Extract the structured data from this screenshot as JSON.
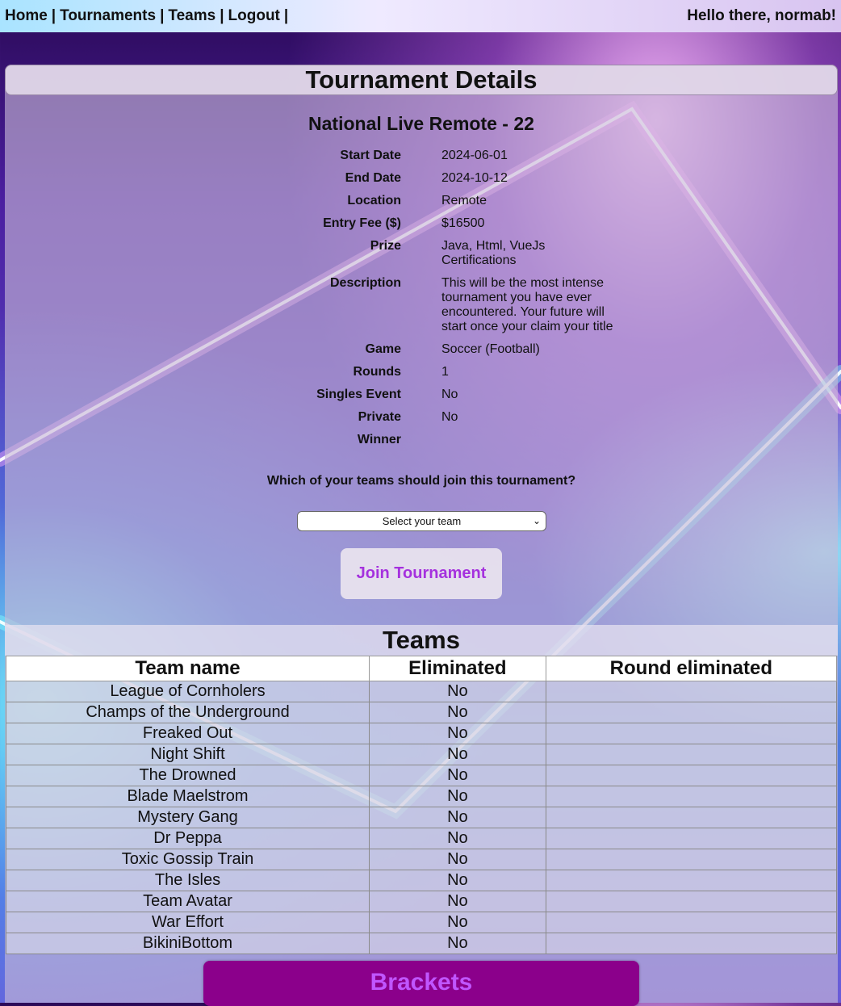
{
  "nav": {
    "links": [
      "Home",
      "Tournaments",
      "Teams",
      "Logout"
    ],
    "separator": "|",
    "greeting": "Hello there, normab!"
  },
  "panel": {
    "title": "Tournament Details",
    "tournament_name": "National Live Remote - 22"
  },
  "details": [
    {
      "label": "Start Date",
      "value": "2024-06-01"
    },
    {
      "label": "End Date",
      "value": "2024-10-12"
    },
    {
      "label": "Location",
      "value": "Remote"
    },
    {
      "label": "Entry Fee ($)",
      "value": "$16500"
    },
    {
      "label": "Prize",
      "value": "Java, Html, VueJs Certifications"
    },
    {
      "label": "Description",
      "value": "This will be the most intense tournament you have ever encountered. Your future will start once your claim your title"
    },
    {
      "label": "Game",
      "value": "Soccer (Football)"
    },
    {
      "label": "Rounds",
      "value": "1"
    },
    {
      "label": "Singles Event",
      "value": "No"
    },
    {
      "label": "Private",
      "value": "No"
    },
    {
      "label": "Winner",
      "value": ""
    }
  ],
  "join": {
    "question": "Which of your teams should join this tournament?",
    "select_value": "Select your team",
    "button_label": "Join Tournament"
  },
  "teams": {
    "title": "Teams",
    "columns": [
      "Team name",
      "Eliminated",
      "Round eliminated"
    ],
    "rows": [
      {
        "name": "League of Cornholers",
        "eliminated": "No",
        "round": ""
      },
      {
        "name": "Champs of the Underground",
        "eliminated": "No",
        "round": ""
      },
      {
        "name": "Freaked Out",
        "eliminated": "No",
        "round": ""
      },
      {
        "name": "Night Shift",
        "eliminated": "No",
        "round": ""
      },
      {
        "name": "The Drowned",
        "eliminated": "No",
        "round": ""
      },
      {
        "name": "Blade Maelstrom",
        "eliminated": "No",
        "round": ""
      },
      {
        "name": "Mystery Gang",
        "eliminated": "No",
        "round": ""
      },
      {
        "name": "Dr Peppa",
        "eliminated": "No",
        "round": ""
      },
      {
        "name": "Toxic Gossip Train",
        "eliminated": "No",
        "round": ""
      },
      {
        "name": "The Isles",
        "eliminated": "No",
        "round": ""
      },
      {
        "name": "Team Avatar",
        "eliminated": "No",
        "round": ""
      },
      {
        "name": "War Effort",
        "eliminated": "No",
        "round": ""
      },
      {
        "name": "BikiniBottom",
        "eliminated": "No",
        "round": ""
      }
    ]
  },
  "brackets": {
    "label": "Brackets"
  },
  "colors": {
    "join_text": "#a531de",
    "brackets_bg": "#8b008b",
    "brackets_text": "#c056ff"
  }
}
